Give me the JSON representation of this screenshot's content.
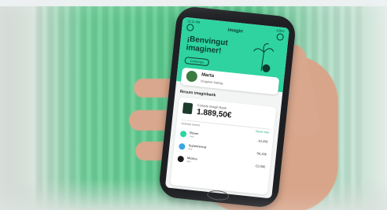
{
  "app": {
    "status_time": "11:11 AM",
    "status_battery": "100%",
    "brand": "imagin"
  },
  "welcome": {
    "title": "¡Benvingut imaginer!",
    "button": "Comença"
  },
  "profile": {
    "name": "Marta",
    "subtitle": "imaginer baking"
  },
  "summary": {
    "section_title": "Resum imaginbank",
    "account_label": "Compte imagin Bank",
    "amount": "1.889,50€",
    "list_header_left": "Activitat recent",
    "list_header_right": "Veure més"
  },
  "transactions": [
    {
      "label": "Bizum",
      "sub": "Avui",
      "amount": "-10,45€",
      "color": "#2ed3a0"
    },
    {
      "label": "Supermercat",
      "sub": "Ahir",
      "amount": "-56,20€",
      "color": "#3aa7e0"
    },
    {
      "label": "Música",
      "sub": "Ahir",
      "amount": "-22,00€",
      "color": "#1b1b1b"
    }
  ]
}
